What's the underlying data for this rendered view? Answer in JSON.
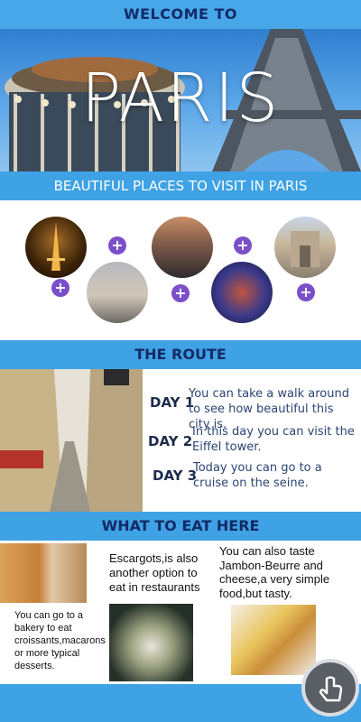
{
  "header": {
    "title": "WELCOME TO"
  },
  "hero": {
    "title": "PARIS"
  },
  "places_section": {
    "title": "BEAUTIFUL PLACES TO VISIT IN PARIS",
    "plus_symbol": "+"
  },
  "route": {
    "title": "THE ROUTE",
    "days": [
      {
        "label": "DAY 1",
        "text": "You can take a walk around to see how beautiful this city is."
      },
      {
        "label": "DAY 2",
        "text": "In this day you can visit the Eiffel tower."
      },
      {
        "label": "DAY 3",
        "text": "Today you can go to a cruise on the seine."
      }
    ]
  },
  "eat": {
    "title": "WHAT TO EAT HERE",
    "items": [
      {
        "text": "You can go to a bakery to eat croissants,macarons or more typical desserts."
      },
      {
        "text": "Escargots,is also another option to eat in restaurants"
      },
      {
        "text": "You can also taste Jambon-Beurre and cheese,a very simple food,but tasty."
      }
    ]
  },
  "colors": {
    "accent": "#3ea2e4",
    "title_dark": "#142a66",
    "plus": "#7a4fc9"
  },
  "icons": {
    "fab": "tap-hand-icon",
    "plus": "plus-icon"
  }
}
